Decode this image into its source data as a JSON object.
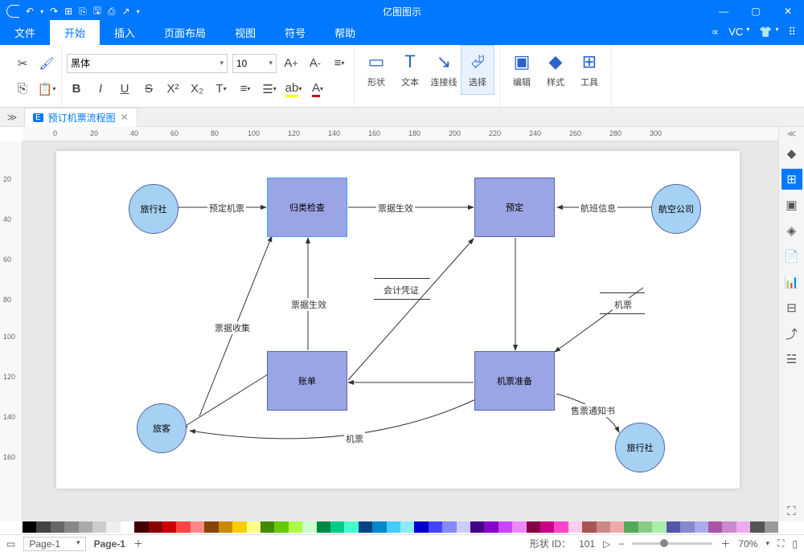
{
  "app_title": "亿图图示",
  "menu": {
    "file": "文件",
    "home": "开始",
    "insert": "插入",
    "page": "页面布局",
    "view": "视图",
    "symbol": "符号",
    "help": "帮助"
  },
  "ribbon": {
    "font_family": "黑体",
    "font_size": "10",
    "shape": "形状",
    "text": "文本",
    "connector": "连接线",
    "select": "选择",
    "edit": "编辑",
    "style": "样式",
    "tools": "工具"
  },
  "doc_tab": "预订机票流程图",
  "diagram": {
    "nodes": {
      "travel_agency": "旅行社",
      "airline": "航空公司",
      "traveler": "旅客",
      "travel_agency2": "旅行社",
      "classify": "归类检查",
      "booking": "预定",
      "bill": "账单",
      "ticket_prep": "机票准备"
    },
    "edges": {
      "book_ticket": "预定机票",
      "voucher_valid": "票据生效",
      "flight_info": "航班信息",
      "voucher_valid2": "票据生效",
      "accounting": "会计凭证",
      "ticket": "机票",
      "collect": "票据收集",
      "ticket2": "机票",
      "sale_notice": "售票通知书"
    }
  },
  "status": {
    "shape_id_label": "形状 ID：",
    "shape_id": "101",
    "zoom": "70%",
    "page": "Page-1",
    "page_tab": "Page-1"
  },
  "colors": [
    "#000",
    "#444",
    "#666",
    "#888",
    "#aaa",
    "#ccc",
    "#eee",
    "#fff",
    "#400",
    "#800",
    "#c00",
    "#f44",
    "#f88",
    "#840",
    "#c80",
    "#fc0",
    "#ff8",
    "#480",
    "#6c0",
    "#af4",
    "#cfc",
    "#084",
    "#0c8",
    "#4fc",
    "#048",
    "#08c",
    "#4cf",
    "#8ef",
    "#00c",
    "#44f",
    "#88f",
    "#ccf",
    "#408",
    "#80c",
    "#c4f",
    "#e8f",
    "#804",
    "#c08",
    "#f4c",
    "#fce",
    "#a55",
    "#c88",
    "#eaa",
    "#5a5",
    "#8c8",
    "#aea",
    "#55a",
    "#88c",
    "#aae",
    "#a5a",
    "#c8c",
    "#eae",
    "#555",
    "#999"
  ],
  "vc": "VC"
}
